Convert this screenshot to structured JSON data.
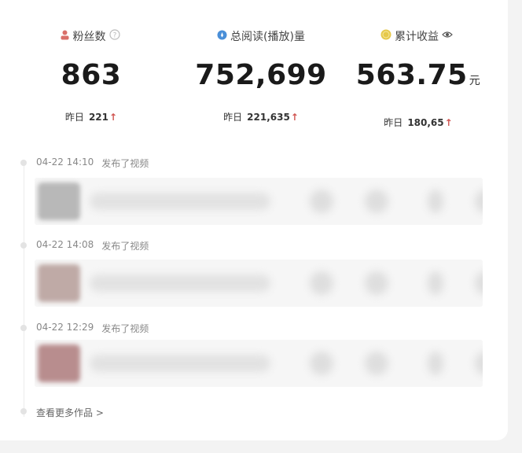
{
  "stats": [
    {
      "label": "粉丝数",
      "value": "863",
      "unit": "",
      "yesterday_label": "昨日",
      "yesterday_value": "221",
      "icon": "user-icon",
      "extra_icon": "help-icon"
    },
    {
      "label": "总阅读(播放)量",
      "value": "752,699",
      "unit": "",
      "yesterday_label": "昨日",
      "yesterday_value": "221,635",
      "icon": "views-icon",
      "extra_icon": ""
    },
    {
      "label": "累计收益",
      "value": "563.75",
      "unit": "元",
      "yesterday_label": "昨日",
      "yesterday_value": "180,65",
      "icon": "coin-icon",
      "extra_icon": "eye-icon"
    }
  ],
  "timeline": [
    {
      "time": "04-22 14:10",
      "action": "发布了视频"
    },
    {
      "time": "04-22 14:08",
      "action": "发布了视频"
    },
    {
      "time": "04-22 12:29",
      "action": "发布了视频"
    }
  ],
  "more_link": "查看更多作品 >",
  "colors": {
    "up_arrow": "#d0534f",
    "user_icon": "#d9706a",
    "views_icon": "#4a8fd8",
    "coin_icon": "#e6c94a"
  }
}
